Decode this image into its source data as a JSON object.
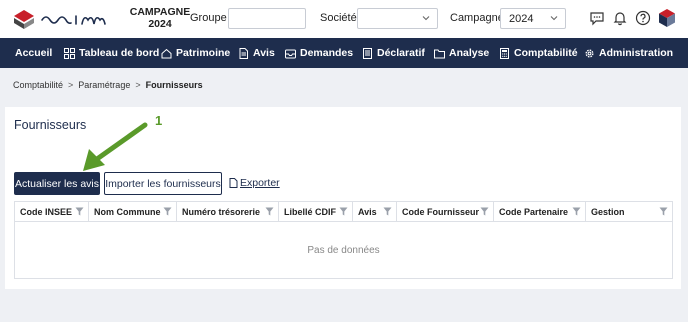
{
  "header": {
    "logo_text": "uim",
    "campagne_title_line1": "CAMPAGNE",
    "campagne_title_line2": "2024",
    "groupe_label": "Groupe :",
    "groupe_value": "",
    "societe_label": "Société :",
    "societe_value": "",
    "campagne_label": "Campagne :",
    "campagne_value": "2024",
    "icons": [
      "chat-icon",
      "bell-icon",
      "help-icon",
      "user-cube-icon"
    ]
  },
  "nav": {
    "items": [
      {
        "label": "Accueil",
        "icon": "none"
      },
      {
        "label": "Tableau de bord",
        "icon": "grid-icon"
      },
      {
        "label": "Patrimoine",
        "icon": "house-icon"
      },
      {
        "label": "Avis",
        "icon": "document-icon"
      },
      {
        "label": "Demandes",
        "icon": "inbox-icon"
      },
      {
        "label": "Déclaratif",
        "icon": "form-icon"
      },
      {
        "label": "Analyse",
        "icon": "folder-icon"
      },
      {
        "label": "Comptabilité",
        "icon": "calculator-icon"
      },
      {
        "label": "Administration",
        "icon": "gear-icon"
      }
    ]
  },
  "breadcrumb": {
    "items": [
      "Comptabilité",
      "Paramétrage",
      "Fournisseurs"
    ],
    "separator": ">"
  },
  "page": {
    "title": "Fournisseurs",
    "annotation_number": "1",
    "annotation_color": "#5a9a2a"
  },
  "actions": {
    "refresh_label": "Actualiser les avis",
    "import_label": "Importer les fournisseurs",
    "export_label": "Exporter"
  },
  "table": {
    "columns": [
      "Code INSEE",
      "Nom Commune",
      "Numéro trésorerie",
      "Libellé CDIF",
      "Avis",
      "Code Fournisseur",
      "Code Partenaire",
      "Gestion"
    ],
    "empty_text": "Pas de données"
  },
  "colors": {
    "primary": "#1e2d4d",
    "annotation": "#5a9a2a",
    "logo_red": "#c8202a"
  }
}
